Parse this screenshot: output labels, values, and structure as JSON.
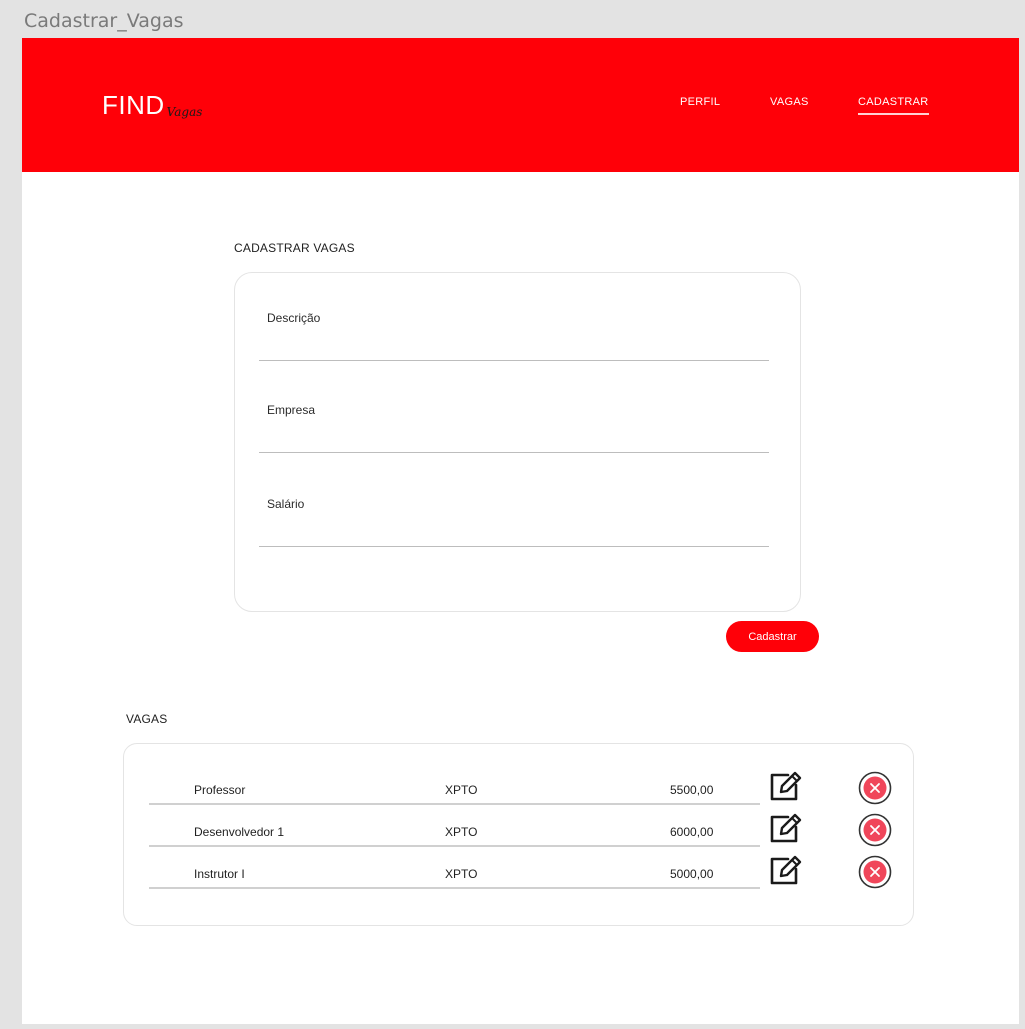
{
  "artboard": {
    "title": "Cadastrar_Vagas"
  },
  "header": {
    "logo_main": "FIND",
    "logo_script": "Vagas",
    "nav": [
      {
        "label": "PERFIL"
      },
      {
        "label": "VAGAS"
      },
      {
        "label": "CADASTRAR",
        "active": true
      }
    ]
  },
  "form": {
    "title": "CADASTRAR VAGAS",
    "fields": [
      {
        "label": "Descrição",
        "value": ""
      },
      {
        "label": "Empresa",
        "value": ""
      },
      {
        "label": "Salário",
        "value": ""
      }
    ],
    "submit_label": "Cadastrar"
  },
  "list": {
    "title": "VAGAS",
    "rows": [
      {
        "descricao": "Professor",
        "empresa": "XPTO",
        "salario": "5500,00"
      },
      {
        "descricao": "Desenvolvedor 1",
        "empresa": "XPTO",
        "salario": "6000,00"
      },
      {
        "descricao": "Instrutor I",
        "empresa": "XPTO",
        "salario": "5000,00"
      }
    ]
  },
  "colors": {
    "brand_red": "#ff0008",
    "delete_red": "#f0465a"
  },
  "icons": {
    "edit": "edit-icon",
    "delete": "delete-icon"
  }
}
